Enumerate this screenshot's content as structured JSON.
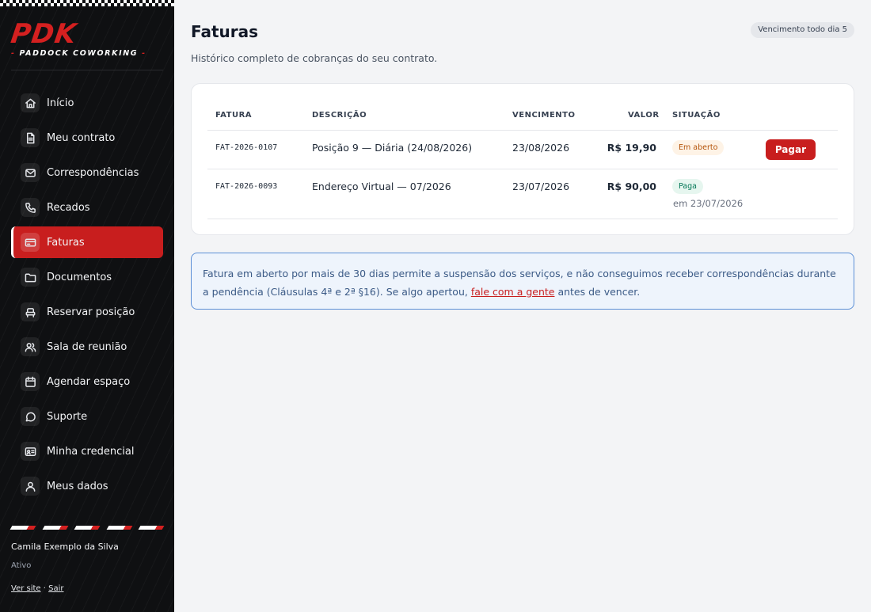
{
  "brand": {
    "logo": "PDK",
    "tagline": "PADDOCK COWORKING",
    "accent": "#c81e1e"
  },
  "sidebar": {
    "items": [
      {
        "label": "Início",
        "icon": "home-icon"
      },
      {
        "label": "Meu contrato",
        "icon": "document-icon"
      },
      {
        "label": "Correspondências",
        "icon": "mail-icon"
      },
      {
        "label": "Recados",
        "icon": "phone-icon"
      },
      {
        "label": "Faturas",
        "icon": "credit-card-icon",
        "active": true
      },
      {
        "label": "Documentos",
        "icon": "folder-icon"
      },
      {
        "label": "Reservar posição",
        "icon": "seat-icon"
      },
      {
        "label": "Sala de reunião",
        "icon": "users-icon"
      },
      {
        "label": "Agendar espaço",
        "icon": "calendar-icon"
      },
      {
        "label": "Suporte",
        "icon": "chat-icon"
      },
      {
        "label": "Minha credencial",
        "icon": "id-card-icon"
      },
      {
        "label": "Meus dados",
        "icon": "user-icon"
      }
    ],
    "user": {
      "name": "Camila Exemplo da Silva",
      "status": "Ativo"
    },
    "links": {
      "site": "Ver site",
      "separator": "·",
      "logout": "Sair"
    }
  },
  "header": {
    "title": "Faturas",
    "subtitle": "Histórico completo de cobranças do seu contrato.",
    "due_badge": "Vencimento todo dia 5"
  },
  "invoices": {
    "columns": {
      "invoice": "FATURA",
      "description": "DESCRIÇÃO",
      "due": "VENCIMENTO",
      "value": "VALOR",
      "status": "SITUAÇÃO"
    },
    "rows": [
      {
        "id": "FAT-2026-0107",
        "description": "Posição 9 — Diária (24/08/2026)",
        "due": "23/08/2026",
        "value": "R$ 19,90",
        "status": "Em aberto",
        "action": "Pagar"
      },
      {
        "id": "FAT-2026-0093",
        "description": "Endereço Virtual — 07/2026",
        "due": "23/07/2026",
        "value": "R$ 90,00",
        "status": "Paga",
        "paid_on": "em 23/07/2026"
      }
    ]
  },
  "notice": {
    "text_before": "Fatura em aberto por mais de 30 dias permite a suspensão dos serviços, e não conseguimos receber correspondências durante a pendência (Cláusulas 4ª e 2ª §16). Se algo apertou, ",
    "link": "fale com a gente",
    "text_after": " antes de vencer."
  }
}
